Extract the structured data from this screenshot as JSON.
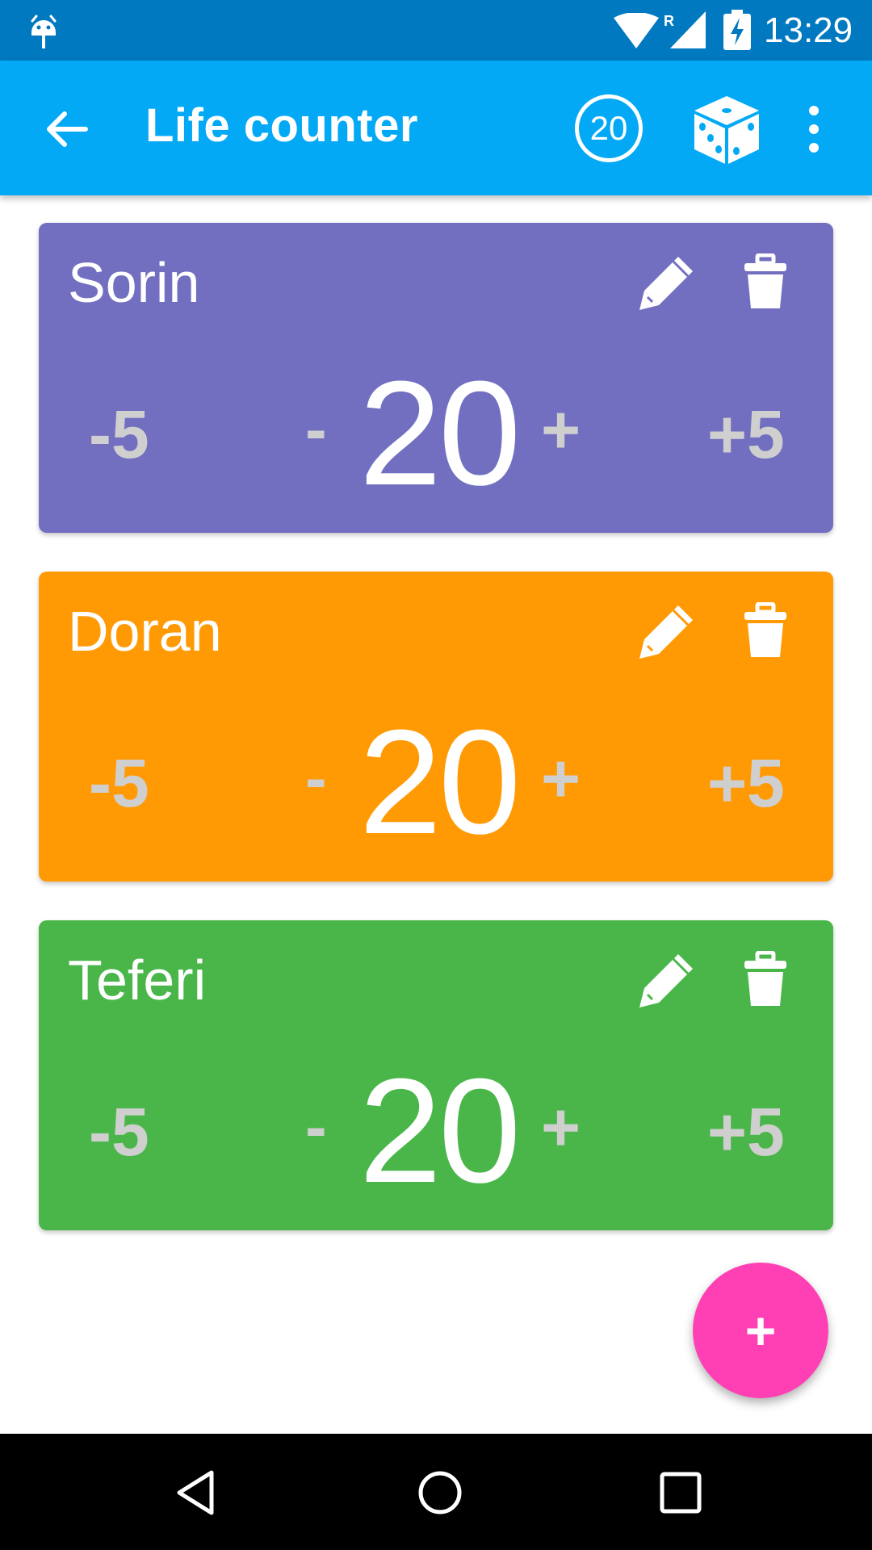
{
  "status_bar": {
    "time": "13:29",
    "icons": [
      "android-debug-icon",
      "wifi-icon",
      "signal-roaming-icon",
      "battery-charging-icon"
    ],
    "roaming_label": "R"
  },
  "app_bar": {
    "title": "Life counter",
    "back_icon": "arrow-back-icon",
    "d20_label": "20",
    "dice_icon": "dice-icon",
    "overflow_icon": "more-vert-icon"
  },
  "players": [
    {
      "name": "Sorin",
      "life": "20",
      "minus5": "-5",
      "minus1": "-",
      "plus1": "+",
      "plus5": "+5",
      "color": "#726fc0"
    },
    {
      "name": "Doran",
      "life": "20",
      "minus5": "-5",
      "minus1": "-",
      "plus1": "+",
      "plus5": "+5",
      "color": "#ff9a05"
    },
    {
      "name": "Teferi",
      "life": "20",
      "minus5": "-5",
      "minus1": "-",
      "plus1": "+",
      "plus5": "+5",
      "color": "#4ab64a"
    }
  ],
  "fab": {
    "label": "+",
    "color": "#ff40b4"
  },
  "nav_bar": {
    "icons": [
      "nav-back-icon",
      "nav-home-icon",
      "nav-recents-icon"
    ]
  },
  "colors": {
    "status_bar": "#0179c0",
    "app_bar": "#03a9f4",
    "secondary_text": "#cfcfcf"
  }
}
